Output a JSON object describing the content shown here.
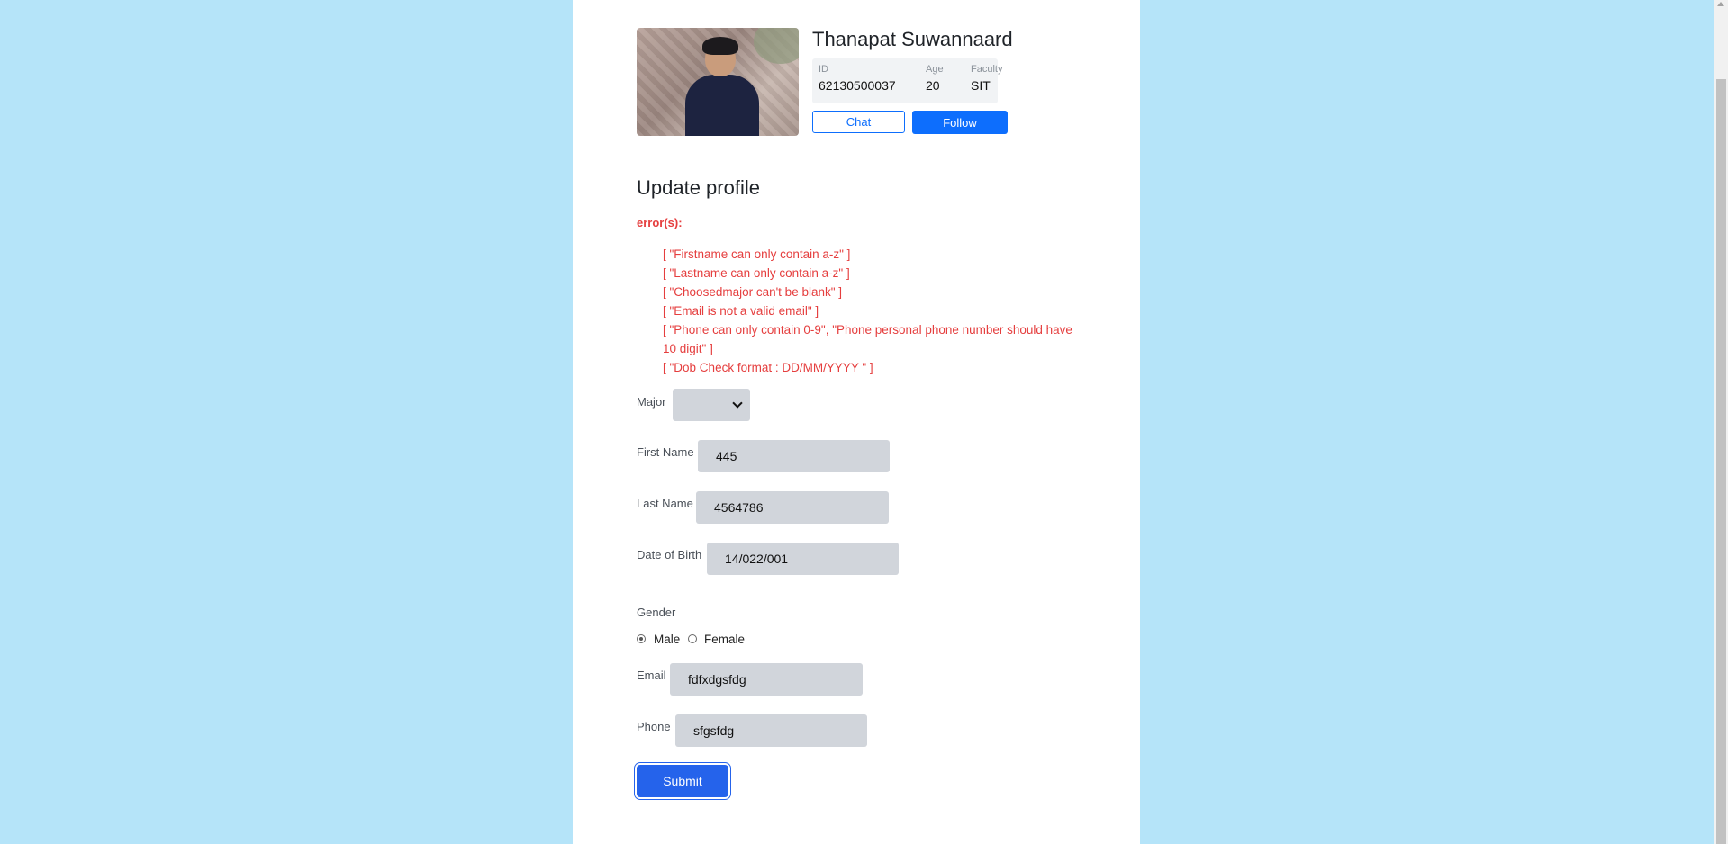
{
  "profile": {
    "name": "Thanapat Suwannaard",
    "stats": [
      {
        "label": "ID",
        "value": "62130500037"
      },
      {
        "label": "Age",
        "value": "20"
      },
      {
        "label": "Faculty",
        "value": "SIT"
      }
    ],
    "chat_label": "Chat",
    "follow_label": "Follow"
  },
  "form": {
    "heading": "Update profile",
    "error_title": "error(s):",
    "errors": [
      "[ \"Firstname can only contain a-z\" ]",
      "[ \"Lastname can only contain a-z\" ]",
      "[ \"Choosedmajor can't be blank\" ]",
      "[ \"Email is not a valid email\" ]",
      "[ \"Phone can only contain 0-9\", \"Phone personal phone number should have 10 digit\" ]",
      "[ \"Dob Check format : DD/MM/YYYY \" ]"
    ],
    "major_label": "Major",
    "first_name_label": "First Name",
    "first_name_value": "445",
    "last_name_label": "Last Name",
    "last_name_value": "4564786",
    "dob_label": "Date of Birth",
    "dob_value": "14/022/001",
    "gender_label": "Gender",
    "gender_options": [
      {
        "label": "Male",
        "checked": true
      },
      {
        "label": "Female",
        "checked": false
      }
    ],
    "email_label": "Email",
    "email_value": "fdfxdgsfdg",
    "phone_label": "Phone",
    "phone_value": "sfgsfdg",
    "submit_label": "Submit"
  },
  "colors": {
    "background": "#b5e4f9",
    "primary": "#0d6efd",
    "error": "#e53e3e",
    "input_bg": "#d1d5db"
  }
}
